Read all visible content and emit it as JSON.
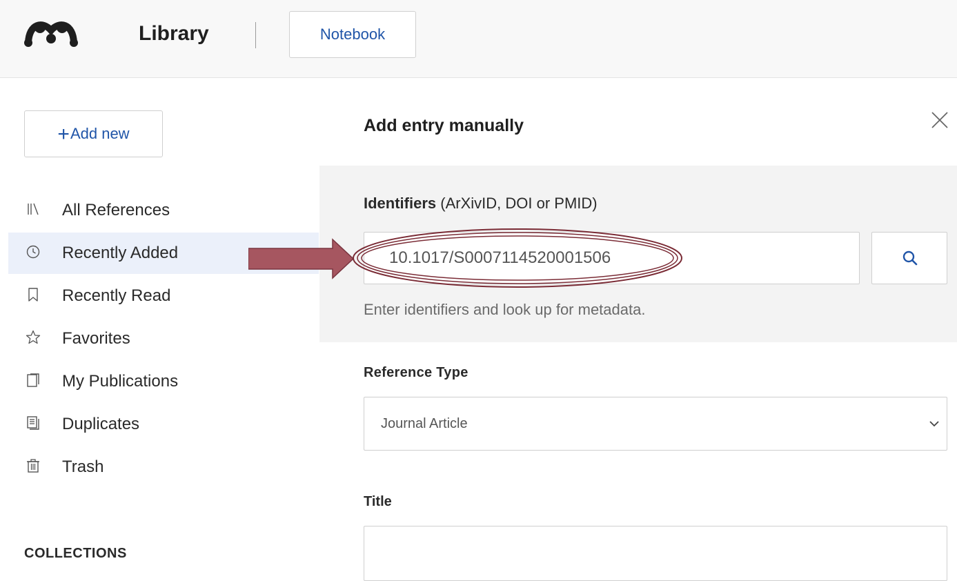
{
  "header": {
    "app_title": "Library",
    "tab_notebook": "Notebook"
  },
  "sidebar": {
    "add_new_label": "Add new",
    "items": [
      {
        "label": "All References",
        "icon": "library-icon",
        "active": false
      },
      {
        "label": "Recently Added",
        "icon": "clock-icon",
        "active": true
      },
      {
        "label": "Recently Read",
        "icon": "bookmark-icon",
        "active": false
      },
      {
        "label": "Favorites",
        "icon": "star-icon",
        "active": false
      },
      {
        "label": "My Publications",
        "icon": "publications-icon",
        "active": false
      },
      {
        "label": "Duplicates",
        "icon": "duplicates-icon",
        "active": false
      },
      {
        "label": "Trash",
        "icon": "trash-icon",
        "active": false
      }
    ],
    "collections_heading": "COLLECTIONS"
  },
  "panel": {
    "title": "Add entry manually",
    "identifiers": {
      "label_bold": "Identifiers",
      "label_rest": " (ArXivID, DOI or PMID)",
      "value": "10.1017/S0007114520001506",
      "help": "Enter identifiers and look up for metadata."
    },
    "reference_type": {
      "label": "Reference Type",
      "value": "Journal Article"
    },
    "title_field": {
      "label": "Title",
      "value": ""
    }
  },
  "colors": {
    "accent": "#2055a8",
    "active_bg": "#ebf0fa",
    "annotation": "#a65660"
  }
}
